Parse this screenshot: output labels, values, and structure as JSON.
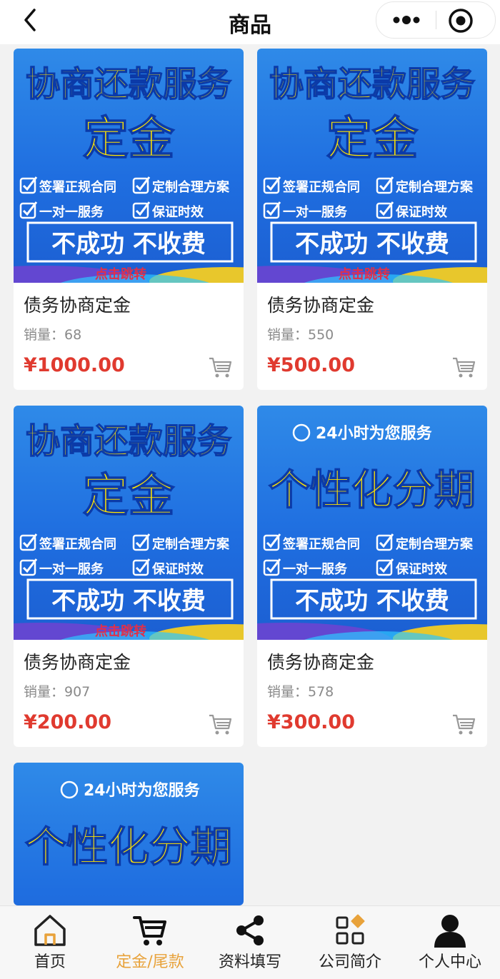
{
  "header": {
    "title": "商品"
  },
  "products": [
    {
      "banner": {
        "headline": "协商还款服务",
        "sub": "定金",
        "badge": "",
        "checks": [
          "签署正规合同",
          "定制合理方案",
          "一对一服务",
          "保证时效"
        ],
        "slogan": "不成功 不收费",
        "tag": "点击跳转"
      },
      "name": "债务协商定金",
      "sales": "销量：68",
      "price": "¥1000.00"
    },
    {
      "banner": {
        "headline": "协商还款服务",
        "sub": "定金",
        "badge": "",
        "checks": [
          "签署正规合同",
          "定制合理方案",
          "一对一服务",
          "保证时效"
        ],
        "slogan": "不成功 不收费",
        "tag": "点击跳转"
      },
      "name": "债务协商定金",
      "sales": "销量：550",
      "price": "¥500.00"
    },
    {
      "banner": {
        "headline": "协商还款服务",
        "sub": "定金",
        "badge": "",
        "checks": [
          "签署正规合同",
          "定制合理方案",
          "一对一服务",
          "保证时效"
        ],
        "slogan": "不成功 不收费",
        "tag": "点击跳转"
      },
      "name": "债务协商定金",
      "sales": "销量：907",
      "price": "¥200.00"
    },
    {
      "banner": {
        "headline": "",
        "sub": "个性化分期",
        "badge": "24小时为您服务",
        "badge_icon": "24",
        "checks": [
          "签署正规合同",
          "定制合理方案",
          "一对一服务",
          "保证时效"
        ],
        "slogan": "不成功 不收费",
        "tag": ""
      },
      "name": "债务协商定金",
      "sales": "销量：578",
      "price": "¥300.00"
    },
    {
      "banner": {
        "headline": "",
        "sub": "个性化分期",
        "badge": "24小时为您服务",
        "badge_icon": "24"
      }
    }
  ],
  "tabs": [
    {
      "label": "首页",
      "icon": "home-icon",
      "active": false
    },
    {
      "label": "定金/尾款",
      "icon": "cart-icon",
      "active": true
    },
    {
      "label": "资料填写",
      "icon": "share-icon",
      "active": false
    },
    {
      "label": "公司简介",
      "icon": "grid-icon",
      "active": false
    },
    {
      "label": "个人中心",
      "icon": "person-icon",
      "active": false
    }
  ],
  "colors": {
    "accent": "#e8a23a",
    "price": "#e03a2f",
    "banner_blue": "#2478e4",
    "headline_yellow": "#ffe600"
  }
}
